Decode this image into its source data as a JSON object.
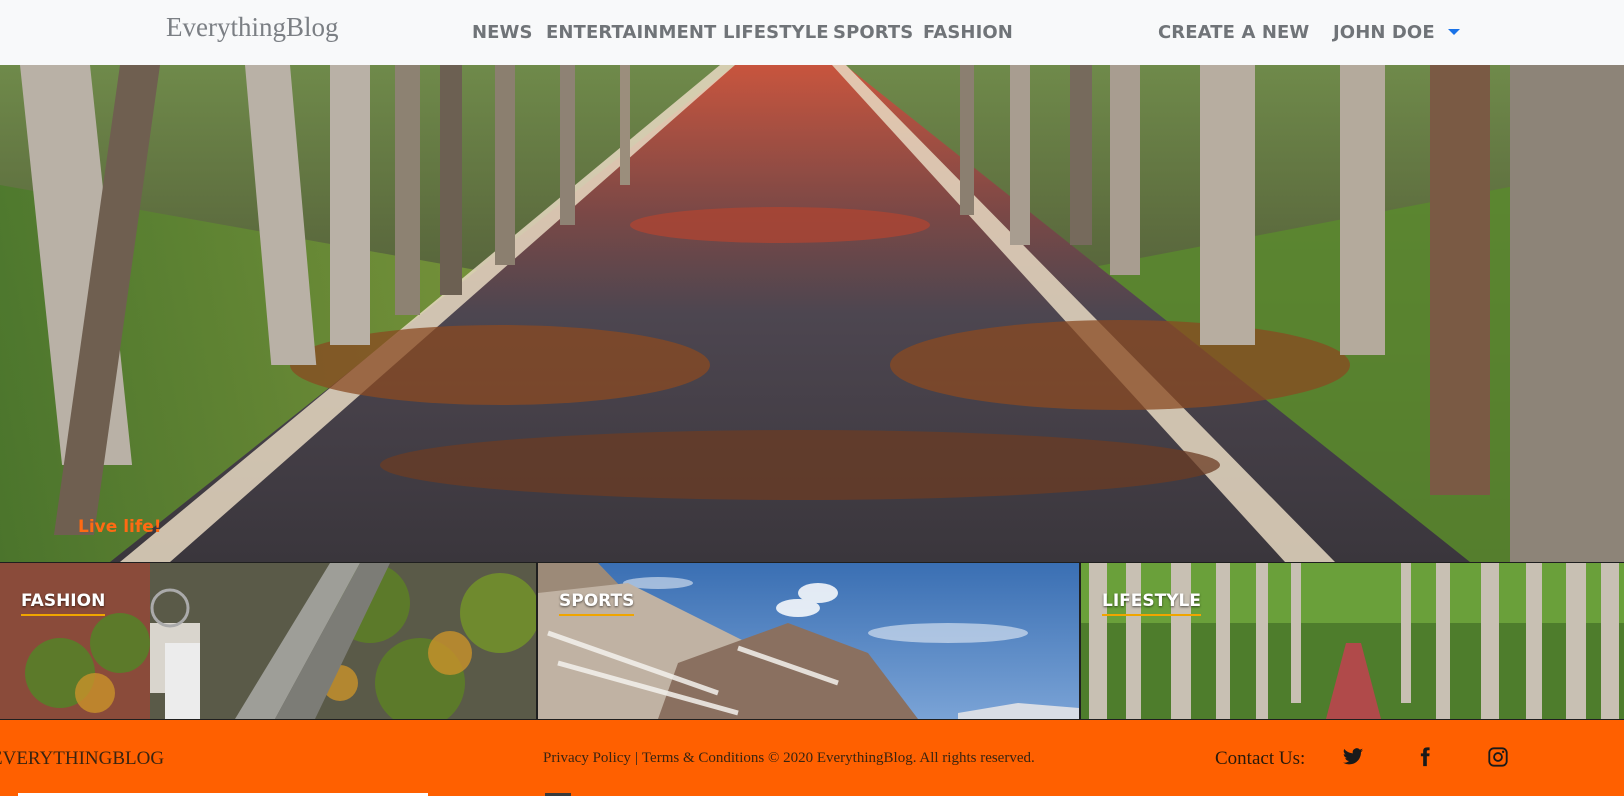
{
  "header": {
    "brand": "EverythingBlog",
    "nav": [
      "NEWS",
      "ENTERTAINMENT",
      "LIFESTYLE",
      "SPORTS",
      "FASHION"
    ],
    "create": "CREATE A NEW",
    "user": "JOHN DOE"
  },
  "hero": {
    "caption": "Live life!"
  },
  "tiles": [
    {
      "label": "FASHION"
    },
    {
      "label": "SPORTS"
    },
    {
      "label": "LIFESTYLE"
    }
  ],
  "footer": {
    "brand": "EverythingBlog",
    "privacy": "Privacy Policy",
    "separator": "|",
    "terms": "Terms & Conditions",
    "copyright": "© 2020 EverythingBlog. All rights reserved.",
    "contact": "Contact Us:",
    "social_icons": [
      "twitter-icon",
      "facebook-icon",
      "instagram-icon"
    ]
  },
  "colors": {
    "accent": "#ff6000",
    "caption": "#ff6a13",
    "caret": "#1a73e8"
  }
}
